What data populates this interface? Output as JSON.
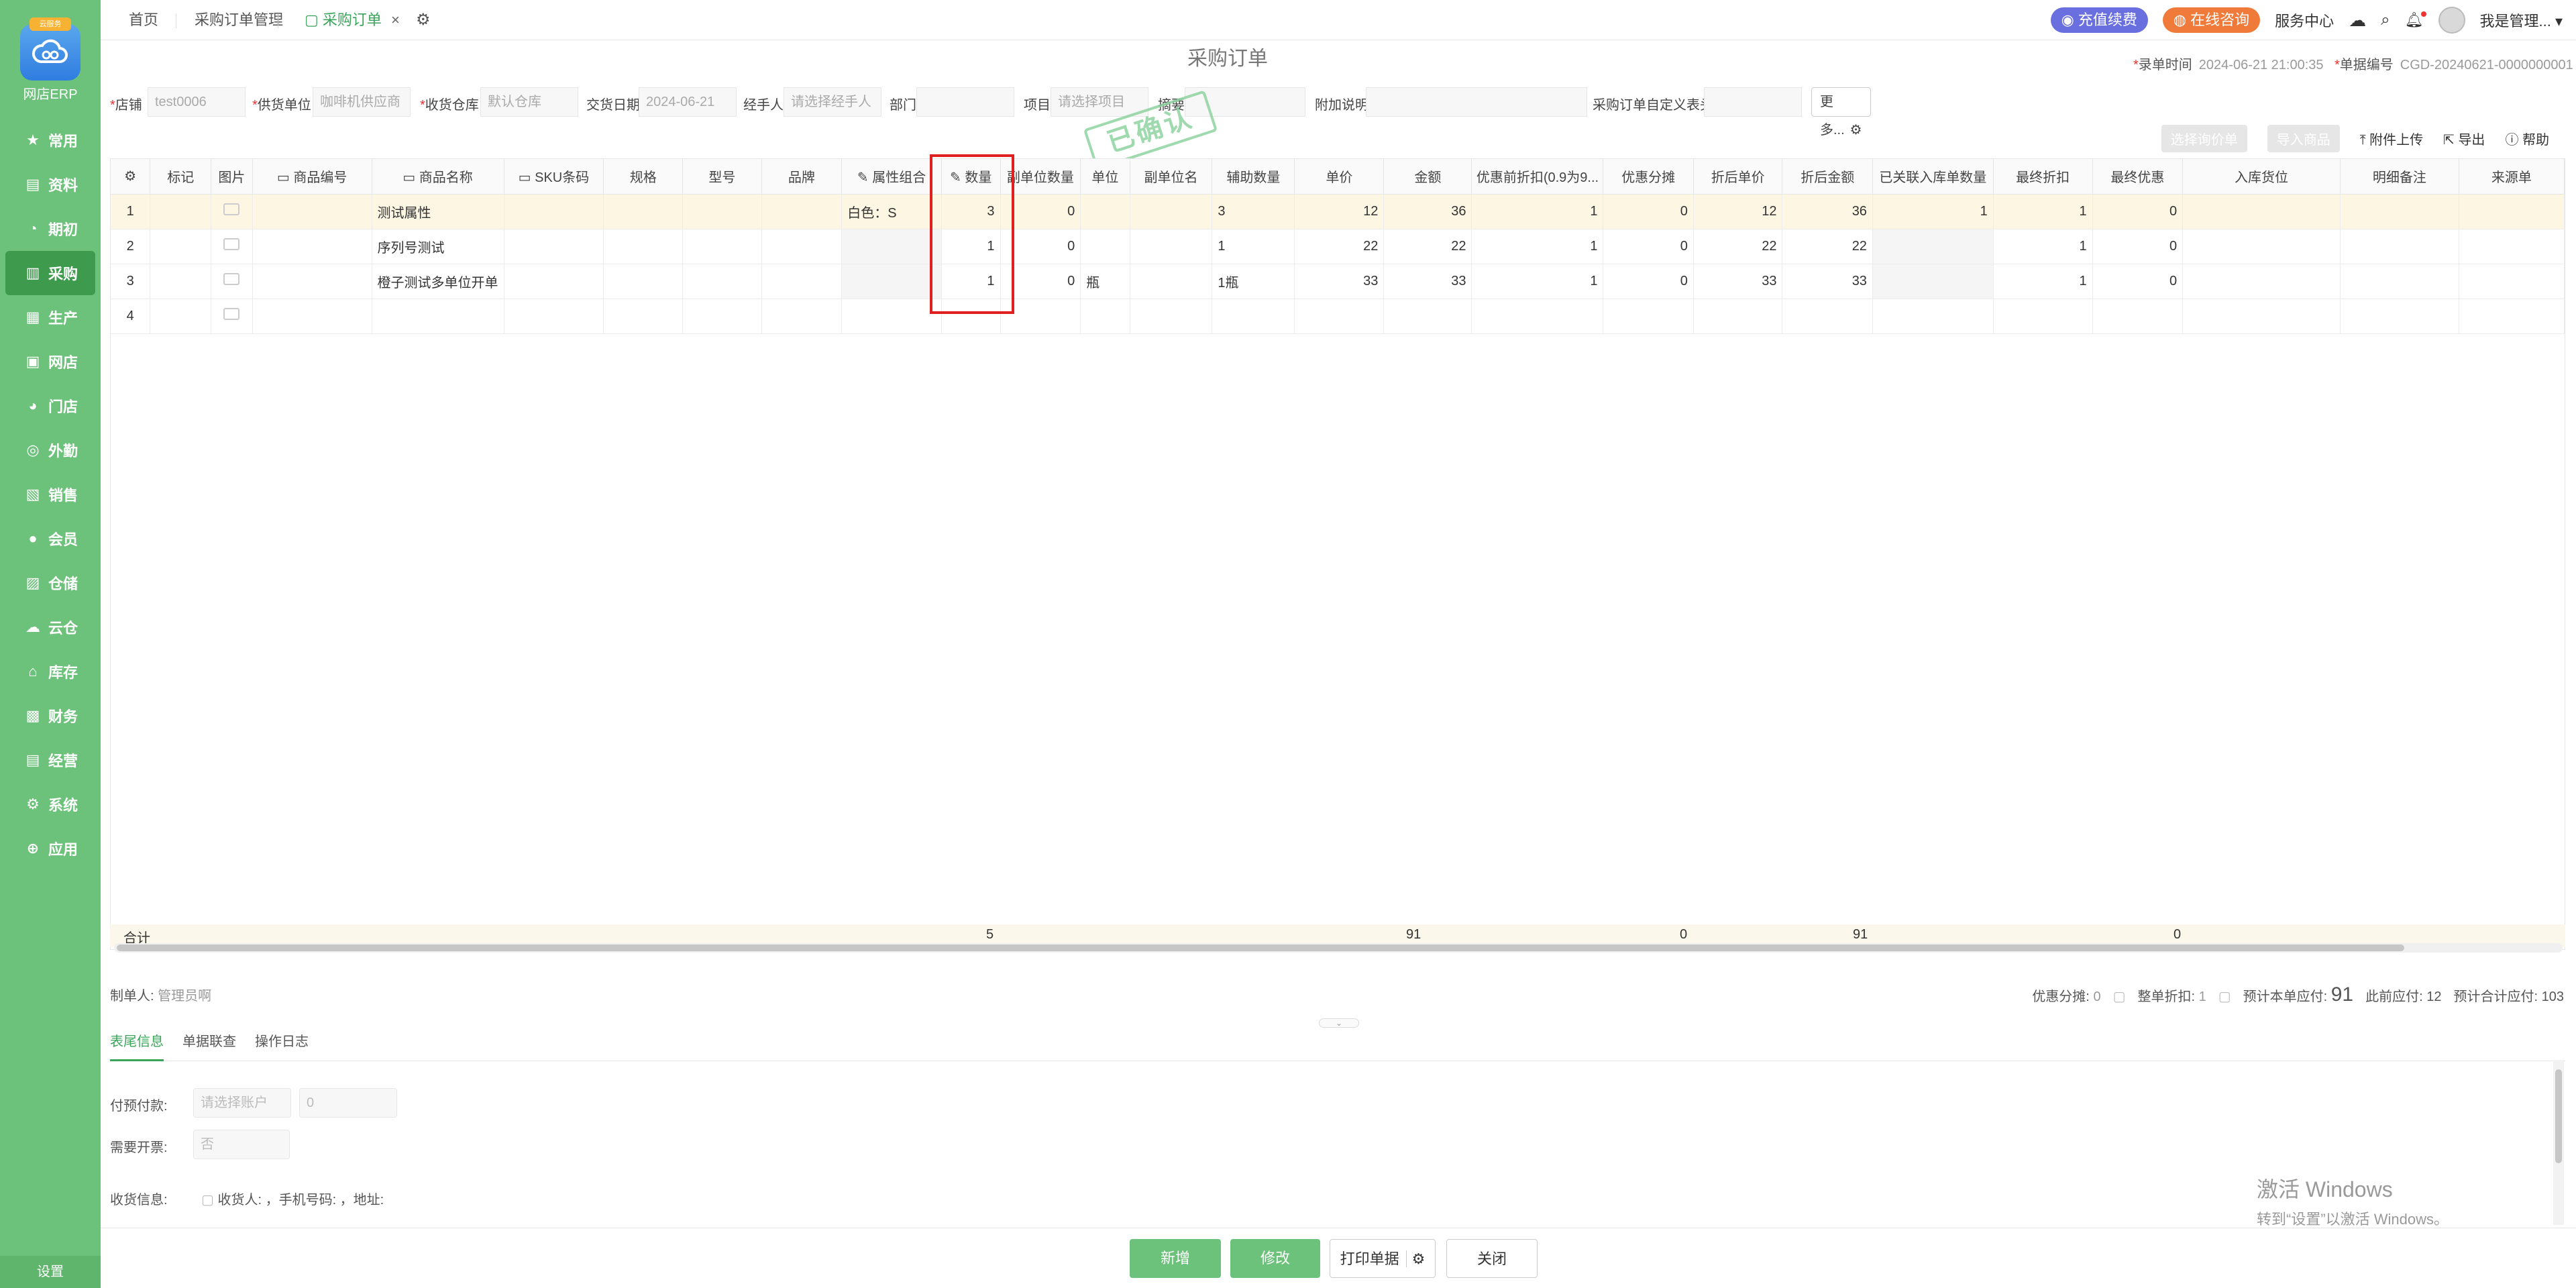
{
  "sidebar": {
    "logo_badge": "云服务",
    "logo_text": "网店ERP",
    "items": [
      {
        "label": "常用",
        "icon": "star-icon"
      },
      {
        "label": "资料",
        "icon": "file-icon"
      },
      {
        "label": "期初",
        "icon": "clock-icon"
      },
      {
        "label": "采购",
        "icon": "cart-icon"
      },
      {
        "label": "生产",
        "icon": "factory-icon"
      },
      {
        "label": "网店",
        "icon": "shop-icon"
      },
      {
        "label": "门店",
        "icon": "store-icon"
      },
      {
        "label": "外勤",
        "icon": "location-icon"
      },
      {
        "label": "销售",
        "icon": "chart-icon"
      },
      {
        "label": "会员",
        "icon": "member-icon"
      },
      {
        "label": "仓储",
        "icon": "warehouse-icon"
      },
      {
        "label": "云仓",
        "icon": "cloud-warehouse-icon"
      },
      {
        "label": "库存",
        "icon": "inventory-icon"
      },
      {
        "label": "财务",
        "icon": "finance-icon"
      },
      {
        "label": "经营",
        "icon": "business-icon"
      },
      {
        "label": "系统",
        "icon": "system-icon"
      },
      {
        "label": "应用",
        "icon": "app-icon"
      }
    ],
    "active_index": 3,
    "settings_label": "设置"
  },
  "tabs": {
    "home": "首页",
    "manage": "采购订单管理",
    "order": "采购订单",
    "close": "×"
  },
  "topright": {
    "recharge": "充值续费",
    "consult": "在线咨询",
    "service": "服务中心",
    "user": "我是管理..."
  },
  "page": {
    "title": "采购订单",
    "entry_time_label": "录单时间",
    "entry_time": "2024-06-21 21:00:35",
    "doc_no_label": "单据编号",
    "doc_no": "CGD-20240621-0000000001"
  },
  "form": {
    "shop_label": "店铺",
    "shop_value": "test0006",
    "supplier_label": "供货单位",
    "supplier_value": "咖啡机供应商",
    "warehouse_label": "收货仓库",
    "warehouse_value": "默认仓库",
    "delivery_label": "交货日期",
    "delivery_value": "2024-06-21",
    "handler_label": "经手人",
    "handler_placeholder": "请选择经手人",
    "dept_label": "部门",
    "dept_value": "",
    "project_label": "项目",
    "project_placeholder": "请选择项目",
    "summary_label": "摘要",
    "summary_value": "",
    "note_label": "附加说明",
    "note_value": "",
    "custom_label": "采购订单自定义表头",
    "custom_value": "",
    "more_label": "更多..."
  },
  "stamp": "已确认",
  "toolbar": {
    "select_request": "选择询价单",
    "import": "导入商品",
    "attach": "附件上传",
    "export": "导出",
    "help": "帮助"
  },
  "table": {
    "headers": [
      "标记",
      "图片",
      "商品编号",
      "商品名称",
      "SKU条码",
      "规格",
      "型号",
      "品牌",
      "属性组合",
      "数量",
      "副单位数量",
      "单位",
      "副单位名",
      "辅助数量",
      "单价",
      "金额",
      "优惠前折扣(0.9为9...",
      "优惠分摊",
      "折后单价",
      "折后金额",
      "已关联入库单数量",
      "最终折扣",
      "最终优惠",
      "入库货位",
      "明细备注",
      "来源单"
    ],
    "rows": [
      {
        "idx": "1",
        "name": "测试属性",
        "attr": "白色：S",
        "qty": "3",
        "sub_qty": "0",
        "unit": "",
        "aux": "3",
        "price": "12",
        "amount": "36",
        "discount": "1",
        "share": "0",
        "dprice": "12",
        "damount": "36",
        "linked": "1",
        "final_disc": "1",
        "final_off": "0"
      },
      {
        "idx": "2",
        "name": "序列号测试",
        "attr": "",
        "qty": "1",
        "sub_qty": "0",
        "unit": "",
        "aux": "1",
        "price": "22",
        "amount": "22",
        "discount": "1",
        "share": "0",
        "dprice": "22",
        "damount": "22",
        "linked": "",
        "final_disc": "1",
        "final_off": "0"
      },
      {
        "idx": "3",
        "name": "橙子测试多单位开单",
        "attr": "",
        "qty": "1",
        "sub_qty": "0",
        "unit": "瓶",
        "aux": "1瓶",
        "price": "33",
        "amount": "33",
        "discount": "1",
        "share": "0",
        "dprice": "33",
        "damount": "33",
        "linked": "",
        "final_disc": "1",
        "final_off": "0"
      },
      {
        "idx": "4",
        "name": "",
        "attr": "",
        "qty": "",
        "sub_qty": "",
        "unit": "",
        "aux": "",
        "price": "",
        "amount": "",
        "discount": "",
        "share": "",
        "dprice": "",
        "damount": "",
        "linked": "",
        "final_disc": "",
        "final_off": ""
      }
    ],
    "total_label": "合计",
    "total_qty": "5",
    "total_amount": "91",
    "total_share": "0",
    "total_damount": "91",
    "total_final_off": "0"
  },
  "footer": {
    "maker_label": "制单人:",
    "maker_value": "管理员啊",
    "share_label": "优惠分摊:",
    "share_value": "0",
    "whole_disc_label": "整单折扣:",
    "whole_disc_value": "1",
    "payable_label": "预计本单应付:",
    "payable_value": "91",
    "prev_label": "此前应付:",
    "prev_value": "12",
    "total_payable_label": "预计合计应付:",
    "total_payable_value": "103"
  },
  "subtabs": [
    "表尾信息",
    "单据联查",
    "操作日志"
  ],
  "tailinfo": {
    "prepay_label": "付预付款:",
    "prepay_account_placeholder": "请选择账户",
    "prepay_amount": "0",
    "invoice_label": "需要开票:",
    "invoice_value": "否",
    "receive_label": "收货信息:",
    "receive_value": "收货人: ，手机号码: ，地址:"
  },
  "watermark": {
    "line1": "激活 Windows",
    "line2": "转到“设置”以激活 Windows。"
  },
  "buttons": {
    "add": "新增",
    "edit": "修改",
    "print": "打印单据",
    "close": "关闭"
  },
  "colors": {
    "sidebar": "#6cc27a",
    "accent": "#3aa55a",
    "highlight_box": "#e02020"
  }
}
